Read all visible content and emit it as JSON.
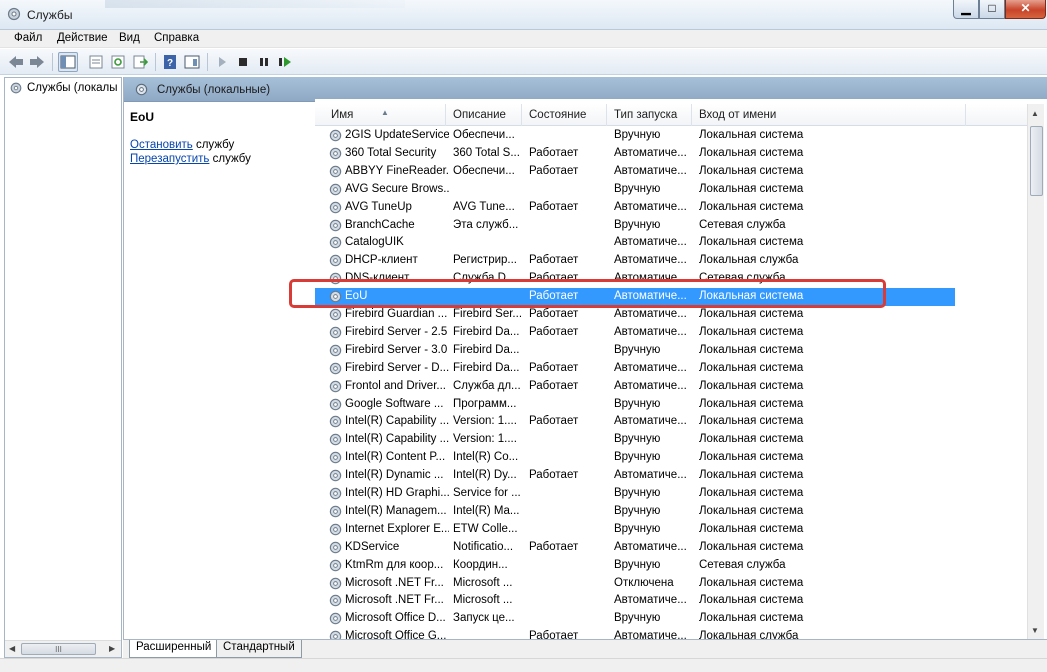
{
  "window": {
    "title": "Службы",
    "buttons": {
      "minimize": "▁",
      "maximize": "□",
      "close": "✕"
    }
  },
  "menu": [
    "Файл",
    "Действие",
    "Вид",
    "Справка"
  ],
  "toolbar": {
    "icons": [
      "back-arrow-icon",
      "forward-arrow-icon",
      "console-tree-icon",
      "properties-icon",
      "refresh-icon",
      "export-list-icon",
      "help-icon",
      "show-hide-icon",
      "play-icon",
      "stop-icon",
      "pause-icon",
      "restart-icon"
    ]
  },
  "tree": {
    "item": "Службы (локалы"
  },
  "main_header": "Службы (локальные)",
  "extended": {
    "service_name": "EoU",
    "stop_link": "Остановить",
    "stop_suffix": " службу",
    "restart_link": "Перезапустить",
    "restart_suffix": " службу"
  },
  "columns": [
    "Имя",
    "Описание",
    "Состояние",
    "Тип запуска",
    "Вход от имени"
  ],
  "rows": [
    {
      "name": "2GIS UpdateService",
      "desc": "Обеспечи...",
      "state": "",
      "start": "Вручную",
      "logon": "Локальная система"
    },
    {
      "name": "360 Total Security",
      "desc": "360 Total S...",
      "state": "Работает",
      "start": "Автоматиче...",
      "logon": "Локальная система"
    },
    {
      "name": "ABBYY FineReader...",
      "desc": "Обеспечи...",
      "state": "Работает",
      "start": "Автоматиче...",
      "logon": "Локальная система"
    },
    {
      "name": "AVG Secure Brows...",
      "desc": "",
      "state": "",
      "start": "Вручную",
      "logon": "Локальная система"
    },
    {
      "name": "AVG TuneUp",
      "desc": "AVG Tune...",
      "state": "Работает",
      "start": "Автоматиче...",
      "logon": "Локальная система"
    },
    {
      "name": "BranchCache",
      "desc": "Эта служб...",
      "state": "",
      "start": "Вручную",
      "logon": "Сетевая служба"
    },
    {
      "name": "CatalogUIK",
      "desc": "",
      "state": "",
      "start": "Автоматиче...",
      "logon": "Локальная система"
    },
    {
      "name": "DHCP-клиент",
      "desc": "Регистрир...",
      "state": "Работает",
      "start": "Автоматиче...",
      "logon": "Локальная служба"
    },
    {
      "name": "DNS-клиент",
      "desc": "Служба D...",
      "state": "Работает",
      "start": "Автоматиче...",
      "logon": "Сетевая служба"
    },
    {
      "name": "EoU",
      "desc": "",
      "state": "Работает",
      "start": "Автоматиче...",
      "logon": "Локальная система",
      "selected": true
    },
    {
      "name": "Firebird Guardian ...",
      "desc": "Firebird Ser...",
      "state": "Работает",
      "start": "Автоматиче...",
      "logon": "Локальная система"
    },
    {
      "name": "Firebird Server - 2.5",
      "desc": "Firebird Da...",
      "state": "Работает",
      "start": "Автоматиче...",
      "logon": "Локальная система"
    },
    {
      "name": "Firebird Server - 3.0",
      "desc": "Firebird Da...",
      "state": "",
      "start": "Вручную",
      "logon": "Локальная система"
    },
    {
      "name": "Firebird Server - D...",
      "desc": "Firebird Da...",
      "state": "Работает",
      "start": "Автоматиче...",
      "logon": "Локальная система"
    },
    {
      "name": "Frontol and Driver...",
      "desc": "Служба дл...",
      "state": "Работает",
      "start": "Автоматиче...",
      "logon": "Локальная система"
    },
    {
      "name": "Google Software ...",
      "desc": "Программ...",
      "state": "",
      "start": "Вручную",
      "logon": "Локальная система"
    },
    {
      "name": "Intel(R) Capability ...",
      "desc": "Version: 1....",
      "state": "Работает",
      "start": "Автоматиче...",
      "logon": "Локальная система"
    },
    {
      "name": "Intel(R) Capability ...",
      "desc": "Version: 1....",
      "state": "",
      "start": "Вручную",
      "logon": "Локальная система"
    },
    {
      "name": "Intel(R) Content P...",
      "desc": "Intel(R) Co...",
      "state": "",
      "start": "Вручную",
      "logon": "Локальная система"
    },
    {
      "name": "Intel(R) Dynamic ...",
      "desc": "Intel(R) Dy...",
      "state": "Работает",
      "start": "Автоматиче...",
      "logon": "Локальная система"
    },
    {
      "name": "Intel(R) HD Graphi...",
      "desc": "Service for ...",
      "state": "",
      "start": "Вручную",
      "logon": "Локальная система"
    },
    {
      "name": "Intel(R) Managem...",
      "desc": "Intel(R) Ma...",
      "state": "",
      "start": "Вручную",
      "logon": "Локальная система"
    },
    {
      "name": "Internet Explorer E...",
      "desc": "ETW Colle...",
      "state": "",
      "start": "Вручную",
      "logon": "Локальная система"
    },
    {
      "name": "KDService",
      "desc": "Notificatio...",
      "state": "Работает",
      "start": "Автоматиче...",
      "logon": "Локальная система"
    },
    {
      "name": "KtmRm для коор...",
      "desc": "Координ...",
      "state": "",
      "start": "Вручную",
      "logon": "Сетевая служба"
    },
    {
      "name": "Microsoft .NET Fr...",
      "desc": "Microsoft ...",
      "state": "",
      "start": "Отключена",
      "logon": "Локальная система"
    },
    {
      "name": "Microsoft .NET Fr...",
      "desc": "Microsoft ...",
      "state": "",
      "start": "Автоматиче...",
      "logon": "Локальная система"
    },
    {
      "name": "Microsoft Office D...",
      "desc": "Запуск це...",
      "state": "",
      "start": "Вручную",
      "logon": "Локальная система"
    },
    {
      "name": "Microsoft Office G...",
      "desc": "",
      "state": "Работает",
      "start": "Автоматиче...",
      "logon": "Локальная служба"
    }
  ],
  "tabs": [
    "Расширенный",
    "Стандартный"
  ],
  "tree_scroll_label": "III"
}
